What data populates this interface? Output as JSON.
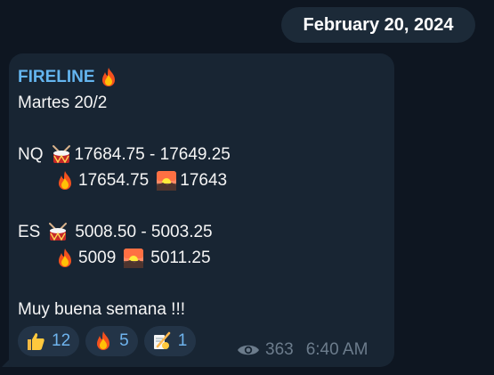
{
  "date_separator": "February 20, 2024",
  "message": {
    "sender": "FIRELINE",
    "line1": "Martes 20/2",
    "nq": {
      "label": "NQ",
      "range": "17684.75 - 17649.25",
      "fire_value": "17654.75",
      "sunset_value": "17643"
    },
    "es": {
      "label": "ES",
      "range": "5008.50 - 5003.25",
      "fire_value": "5009",
      "sunset_value": "5011.25"
    },
    "closing": "Muy buena semana !!!",
    "reactions": [
      {
        "icon": "thumbs-up-emoji",
        "count": "12"
      },
      {
        "icon": "fire-emoji",
        "count": "5"
      },
      {
        "icon": "writing-hand-emoji",
        "count": "1"
      }
    ],
    "views": "363",
    "time": "6:40 AM"
  },
  "colors": {
    "background": "#0e1621",
    "bubble": "#182533",
    "accent": "#64b5ef",
    "meta": "#6c7c8c"
  }
}
